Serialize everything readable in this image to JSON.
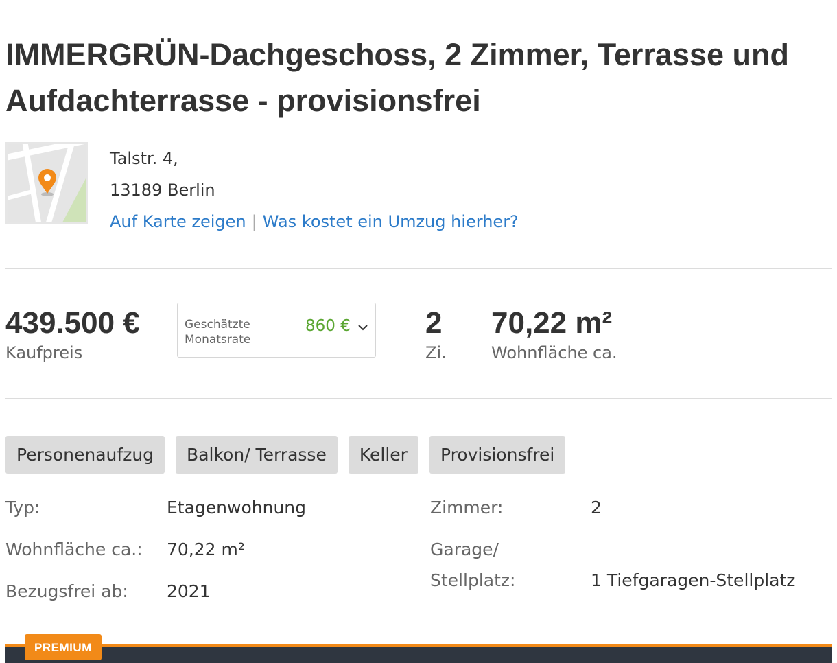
{
  "listing": {
    "title": "IMMERGRÜN-Dachgeschoss, 2 Zimmer, Terrasse und Aufdachterrasse - provisionsfrei",
    "address": {
      "street": "Talstr. 4,",
      "city": "13189 Berlin",
      "map_link": "Auf Karte zeigen",
      "separator": "|",
      "moving_cost_link": "Was kostet ein Umzug hierher?"
    },
    "key_facts": {
      "price_value": "439.500 €",
      "price_label": "Kaufpreis",
      "rate_label": "Geschätzte Monatsrate",
      "rate_value": "860 €",
      "rooms_value": "2",
      "rooms_label": "Zi.",
      "area_value": "70,22 m²",
      "area_label": "Wohnfläche ca."
    },
    "tags": [
      "Personenaufzug",
      "Balkon/ Terrasse",
      "Keller",
      "Provisionsfrei"
    ],
    "details": {
      "typ_label": "Typ:",
      "typ_value": "Etagenwohnung",
      "area_label": "Wohnfläche ca.:",
      "area_value": "70,22 m²",
      "available_label": "Bezugsfrei ab:",
      "available_value": "2021",
      "rooms_label": "Zimmer:",
      "rooms_value": "2",
      "garage_label_1": "Garage/",
      "garage_label_2": "Stellplatz:",
      "garage_value": "1 Tiefgaragen-Stellplatz"
    },
    "premium_badge": "PREMIUM"
  },
  "colors": {
    "link": "#2c7bc9",
    "rate_green": "#5aa631",
    "premium_orange": "#f28a18",
    "premium_bar": "#2f3640",
    "map_pin": "#f28a18"
  },
  "icons": {
    "map_pin": "map-pin-icon",
    "rate_toggle": "chevron-down-icon"
  }
}
